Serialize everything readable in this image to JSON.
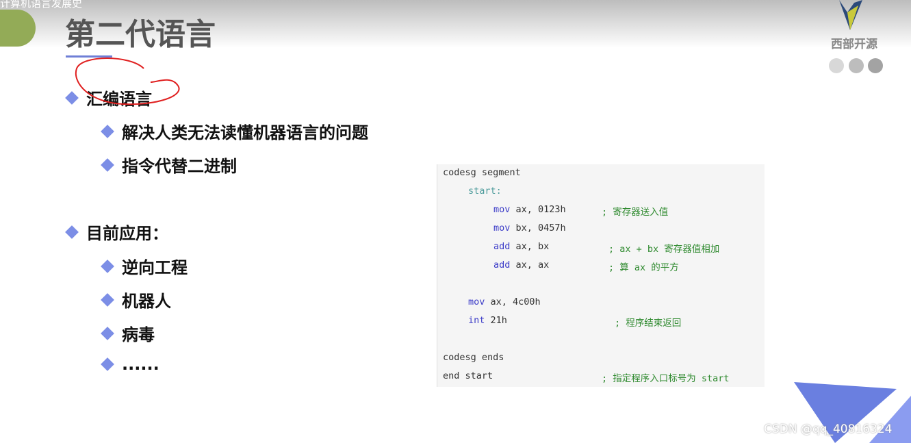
{
  "video_title": "计算机语言发展史",
  "slide": {
    "title": "第二代语言",
    "bullets": [
      {
        "text": "汇编语言",
        "level": 1
      },
      {
        "text": "解决人类无法读懂机器语言的问题",
        "level": 2
      },
      {
        "text": "指令代替二进制",
        "level": 2
      },
      {
        "text": "目前应用：",
        "level": 1
      },
      {
        "text": "逆向工程",
        "level": 2
      },
      {
        "text": "机器人",
        "level": 2
      },
      {
        "text": "病毒",
        "level": 2
      },
      {
        "text": "......",
        "level": 2
      }
    ],
    "code": [
      {
        "kw": "",
        "rest": "codesg segment",
        "comment": ""
      },
      {
        "kw": "",
        "label": "start:",
        "rest": "",
        "comment": ""
      },
      {
        "kw": "mov",
        "rest": " ax, 0123h",
        "comment": "; 寄存器送入值"
      },
      {
        "kw": "mov",
        "rest": " bx, 0457h",
        "comment": ""
      },
      {
        "kw": "add",
        "rest": " ax, bx",
        "comment": "; ax + bx 寄存器值相加"
      },
      {
        "kw": "add",
        "rest": " ax, ax",
        "comment": "; 算 ax 的平方"
      },
      {
        "kw": "mov",
        "rest": " ax, 4c00h",
        "comment": ""
      },
      {
        "kw": "int",
        "rest": " 21h",
        "comment": "; 程序结束返回"
      },
      {
        "kw": "",
        "rest": "codesg ends",
        "comment": ""
      },
      {
        "kw": "",
        "rest": "end start",
        "comment": "; 指定程序入口标号为 start"
      }
    ]
  },
  "brand": "西部开源",
  "watermark": "CSDN @qq_40816324",
  "colors": {
    "accent": "#7c8ee6",
    "green": "#93ab57"
  }
}
